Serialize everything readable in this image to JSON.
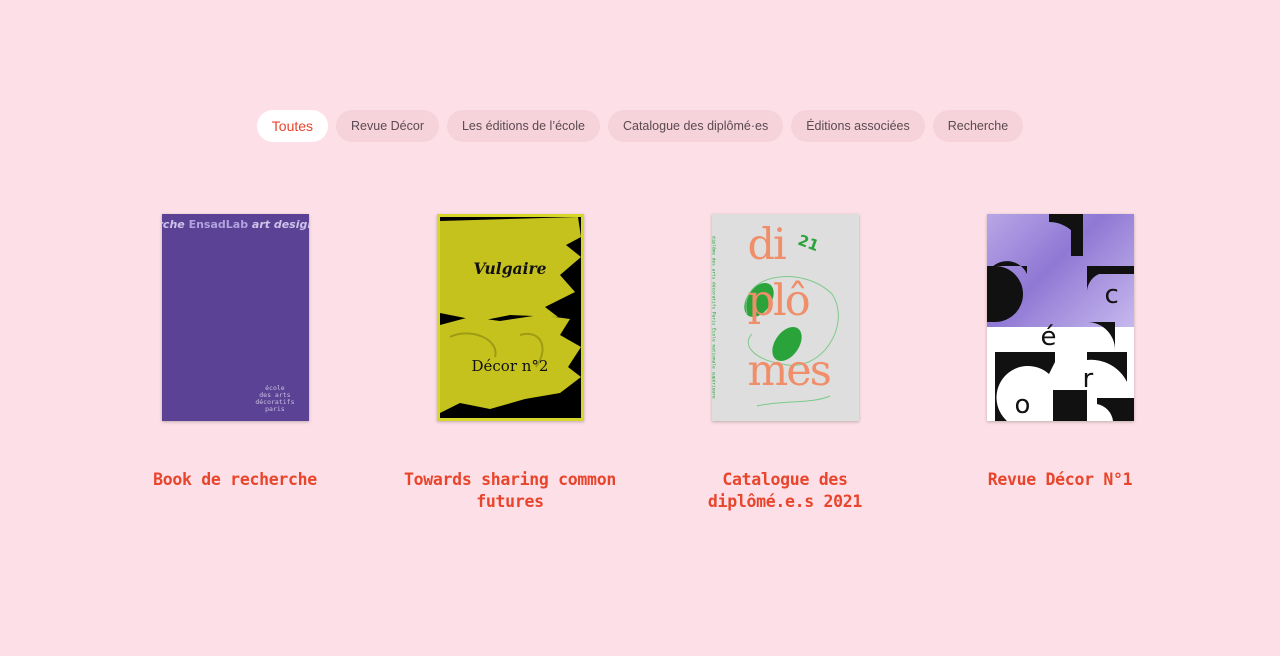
{
  "filters": [
    {
      "label": "Toutes",
      "active": true
    },
    {
      "label": "Revue Décor",
      "active": false
    },
    {
      "label": "Les éditions de l’école",
      "active": false
    },
    {
      "label": "Catalogue des diplômé·es",
      "active": false
    },
    {
      "label": "Éditions associées",
      "active": false
    },
    {
      "label": "Recherche",
      "active": false
    }
  ],
  "cards": [
    {
      "title": "Book de recherche",
      "cover": {
        "band_italic_left": "rche ",
        "band_bold": "EnsadLab",
        "band_italic_right": " art design reche",
        "ecole_lines": [
          "école",
          "des arts",
          "décoratifs",
          "paris"
        ]
      }
    },
    {
      "title": "Towards sharing common futures",
      "cover": {
        "line1": "Vulgaire",
        "line2": "Décor n°2"
      }
    },
    {
      "title": "Catalogue des diplômé.e.s 2021",
      "cover": {
        "big_lines": [
          "di",
          "plô",
          "mes"
        ],
        "year": "21",
        "side_text": "diplôme des arts décoratifs Paris École nationale supérieure"
      }
    },
    {
      "title": "Revue Décor N°1",
      "cover": {
        "letters": [
          "D",
          "c",
          "é",
          "r",
          "o"
        ]
      }
    }
  ],
  "colors": {
    "background": "#fde0e7",
    "accent": "#e8452c",
    "pill": "#f6d2da"
  }
}
